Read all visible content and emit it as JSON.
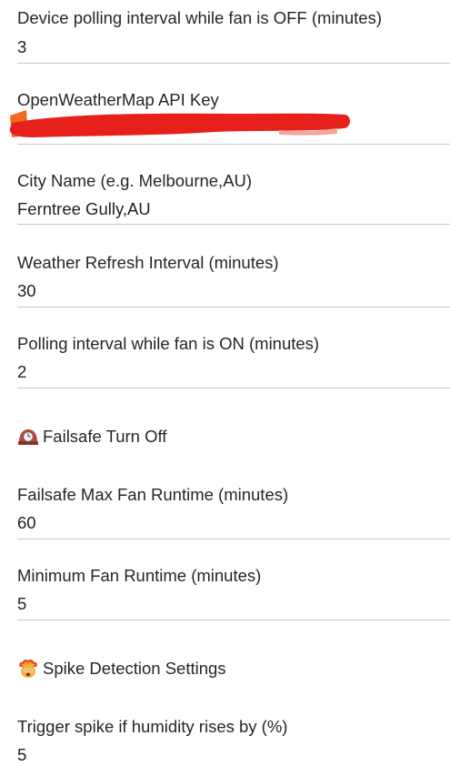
{
  "fields": [
    {
      "label": "Device polling interval while fan is OFF (minutes)",
      "value": "3"
    },
    {
      "label": "OpenWeatherMap API Key",
      "value": ""
    },
    {
      "label": "City Name (e.g. Melbourne,AU)",
      "value": "Ferntree Gully,AU"
    },
    {
      "label": "Weather Refresh Interval (minutes)",
      "value": "30"
    },
    {
      "label": "Polling interval while fan is ON (minutes)",
      "value": "2"
    }
  ],
  "failsafe_section": {
    "title": "Failsafe Turn Off",
    "icon": "mantelpiece-clock-icon",
    "fields": [
      {
        "label": "Failsafe Max Fan Runtime (minutes)",
        "value": "60"
      },
      {
        "label": "Minimum Fan Runtime (minutes)",
        "value": "5"
      }
    ]
  },
  "spike_section": {
    "title": "Spike Detection Settings",
    "icon": "exploding-head-icon",
    "fields": [
      {
        "label": "Trigger spike if humidity rises by (%)",
        "value": "5"
      }
    ]
  },
  "colors": {
    "redaction": "#e8201c",
    "redaction_edge": "#f26a21",
    "divider": "#c7c7c7"
  }
}
